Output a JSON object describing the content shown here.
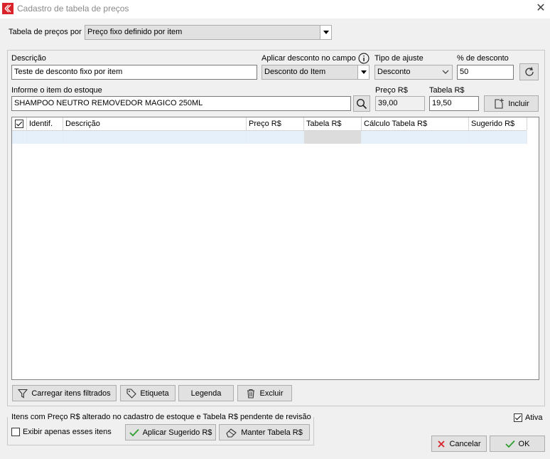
{
  "window": {
    "title": "Cadastro de tabela de preços"
  },
  "top": {
    "label": "Tabela de preços por",
    "selected": "Preço fixo definido por item"
  },
  "form": {
    "descricao_label": "Descrição",
    "descricao_value": "Teste de desconto fixo por item",
    "aplicar_label": "Aplicar desconto no campo",
    "aplicar_value": "Desconto do Item",
    "tipo_label": "Tipo de ajuste",
    "tipo_value": "Desconto",
    "perc_label": "% de desconto",
    "perc_value": "50",
    "item_label": "Informe o item do estoque",
    "item_value": "SHAMPOO NEUTRO REMOVEDOR MAGICO 250ML",
    "preco_label": "Preço R$",
    "preco_value": "39,00",
    "tabela_label": "Tabela R$",
    "tabela_value": "19,50",
    "incluir_label": "Incluir"
  },
  "grid": {
    "columns": [
      "Identif.",
      "Descrição",
      "Preço R$",
      "Tabela R$",
      "Cálculo Tabela R$",
      "Sugerido R$"
    ]
  },
  "grid_buttons": {
    "carregar": "Carregar itens filtrados",
    "etiqueta": "Etiqueta",
    "legenda": "Legenda",
    "excluir": "Excluir"
  },
  "bottom": {
    "group_title": "Itens com Preço R$ alterado no cadastro de estoque e Tabela R$ pendente de revisão",
    "exibir_label": "Exibir apenas esses itens",
    "aplicar_label": "Aplicar Sugerido R$",
    "manter_label": "Manter Tabela R$",
    "ativa_label": "Ativa",
    "ativa_checked": true,
    "cancelar_label": "Cancelar",
    "ok_label": "OK"
  },
  "colors": {
    "accent_red": "#d9232a",
    "ok_green": "#2e9e2e",
    "row_highlight": "#e5f0fb"
  }
}
